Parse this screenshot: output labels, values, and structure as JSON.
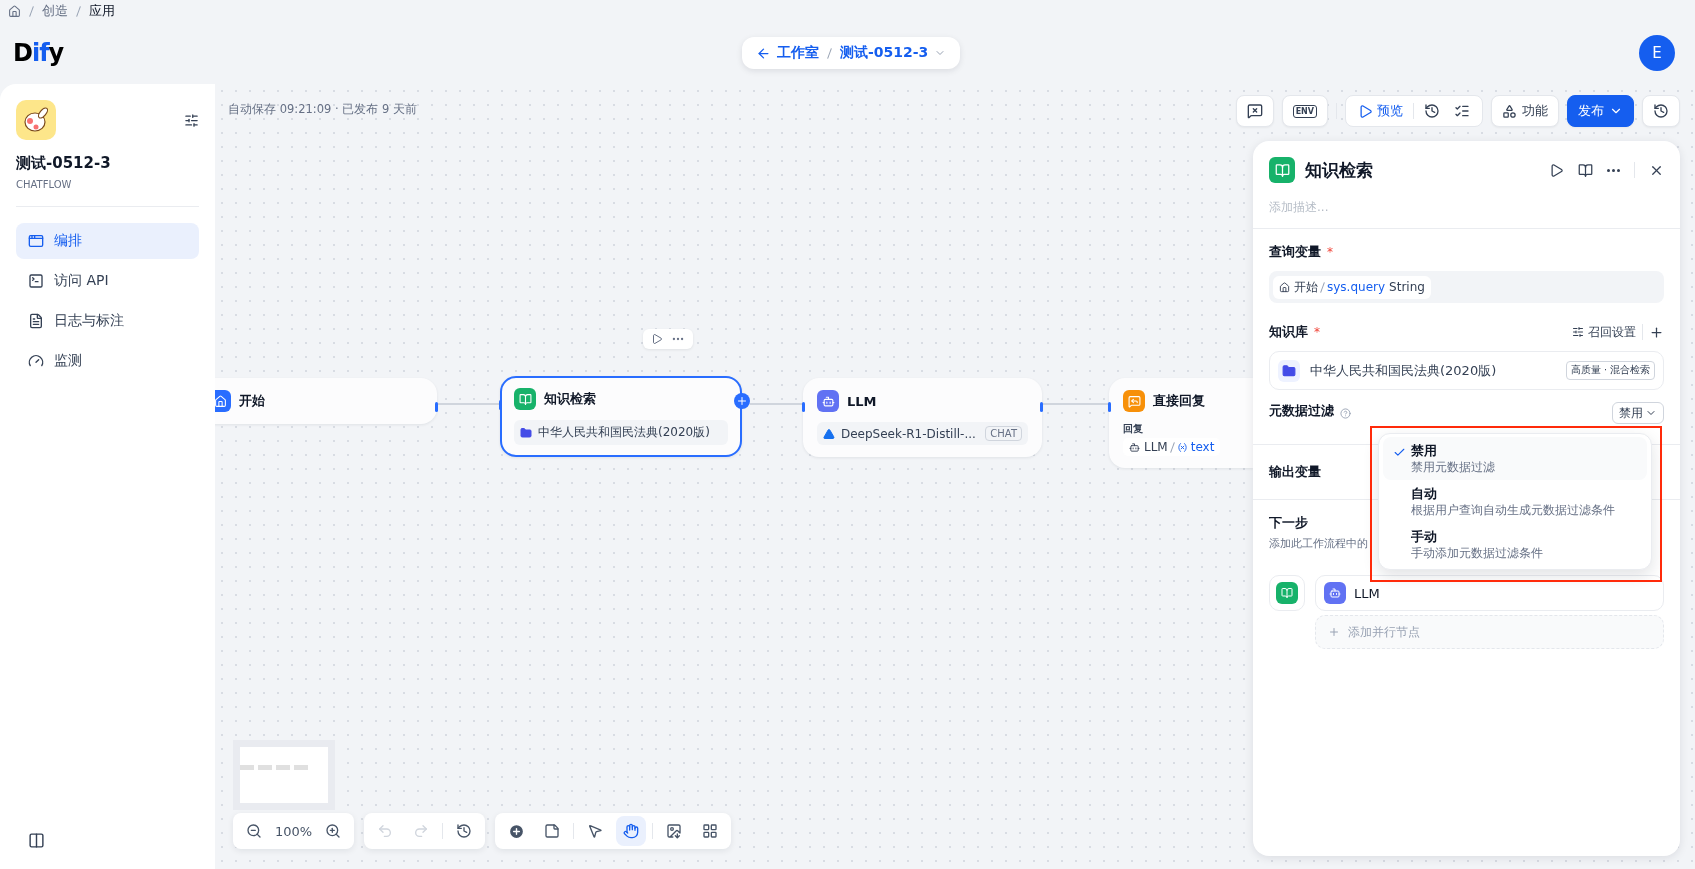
{
  "breadcrumb": [
    "创造",
    "应用"
  ],
  "logo_parts": [
    "D",
    "if",
    "y"
  ],
  "nav_pill": {
    "back_label": "工作室",
    "app_name": "测试-0512-3"
  },
  "avatar": "E",
  "app": {
    "name": "测试-0512-3",
    "type": "CHATFLOW"
  },
  "sidebar_items": [
    {
      "label": "编排",
      "selected": true
    },
    {
      "label": "访问 API",
      "selected": false
    },
    {
      "label": "日志与标注",
      "selected": false
    },
    {
      "label": "监测",
      "selected": false
    }
  ],
  "autosave": "自动保存 09:21:09 · 已发布 9 天前",
  "toolbar": {
    "env": "ENV",
    "preview": "预览",
    "features": "功能",
    "publish": "发布"
  },
  "nodes": [
    {
      "kind": "start",
      "title": "开始",
      "selected": false
    },
    {
      "kind": "knowledge",
      "title": "知识检索",
      "selected": true,
      "dataset": "中华人民共和国民法典(2020版)"
    },
    {
      "kind": "llm",
      "title": "LLM",
      "selected": false,
      "model": "DeepSeek-R1-Distill-...",
      "mode": "CHAT"
    },
    {
      "kind": "answer",
      "title": "直接回复",
      "selected": false,
      "label": "回复",
      "source": "LLM",
      "variable": "text"
    }
  ],
  "panel": {
    "title": "知识检索",
    "description_placeholder": "添加描述...",
    "query_label": "查询变量",
    "query_required": "*",
    "query_node": "开始",
    "query_var": "sys.query",
    "query_type": "String",
    "kb_label": "知识库",
    "kb_required": "*",
    "recall_settings": "召回设置",
    "kb_name": "中华人民共和国民法典(2020版)",
    "kb_badge": "高质量 · 混合检索",
    "filter_label": "元数据过滤",
    "filter_value": "禁用",
    "output_label": "输出变量",
    "next_label": "下一步",
    "next_desc": "添加此工作流程中的",
    "next_node": "LLM",
    "add_parallel": "添加并行节点"
  },
  "filter_options": [
    {
      "title": "禁用",
      "desc": "禁用元数据过滤",
      "selected": true
    },
    {
      "title": "自动",
      "desc": "根据用户查询自动生成元数据过滤条件",
      "selected": false
    },
    {
      "title": "手动",
      "desc": "手动添加元数据过滤条件",
      "selected": false
    }
  ],
  "zoom": "100%",
  "canvas_tools": [
    {
      "kind": "pointer",
      "selected": false
    },
    {
      "kind": "hand",
      "selected": true
    }
  ]
}
